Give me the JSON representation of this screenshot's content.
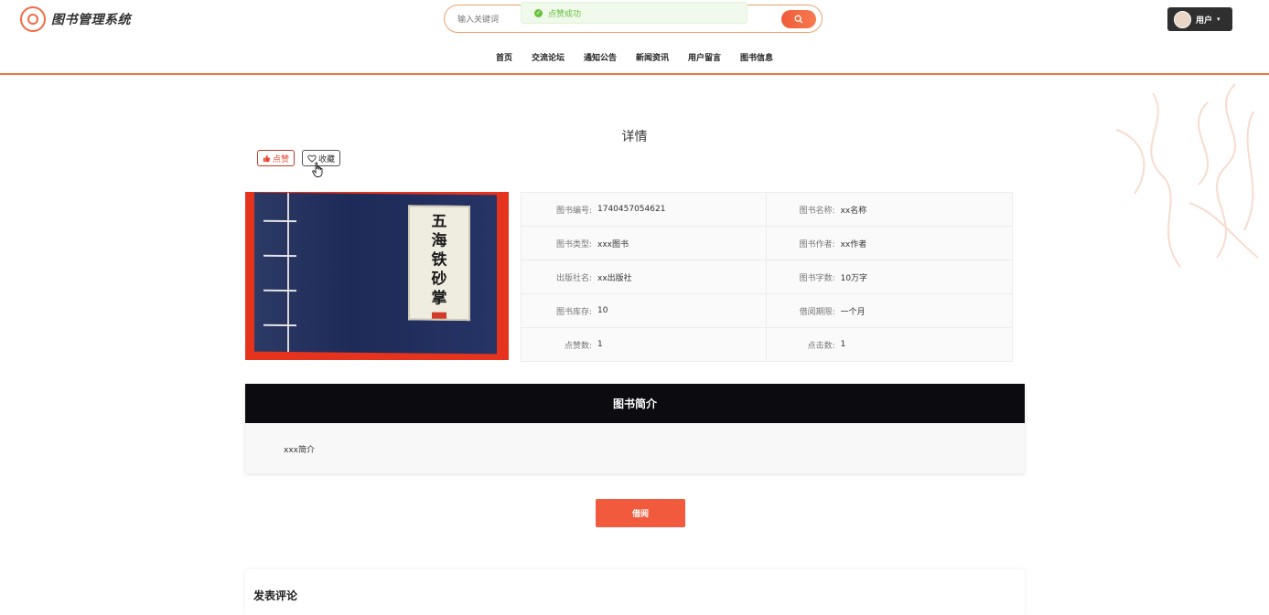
{
  "app": {
    "title": "图书管理系统"
  },
  "search": {
    "placeholder": "输入关键词"
  },
  "toast": {
    "text": "点赞成功"
  },
  "user": {
    "label": "用户"
  },
  "nav": {
    "items": [
      "首页",
      "交流论坛",
      "通知公告",
      "新闻资讯",
      "用户留言",
      "图书信息"
    ]
  },
  "detail": {
    "title": "详情"
  },
  "actions": {
    "like": "点赞",
    "favorite": "收藏"
  },
  "cover": {
    "chars": [
      "五",
      "海",
      "铁",
      "砂",
      "掌"
    ]
  },
  "info": {
    "rows": [
      [
        {
          "label": "图书编号:",
          "value": "1740457054621"
        },
        {
          "label": "图书名称:",
          "value": "xx名称"
        }
      ],
      [
        {
          "label": "图书类型:",
          "value": "xxx图书"
        },
        {
          "label": "图书作者:",
          "value": "xx作者"
        }
      ],
      [
        {
          "label": "出版社名:",
          "value": "xx出版社"
        },
        {
          "label": "图书字数:",
          "value": "10万字"
        }
      ],
      [
        {
          "label": "图书库存:",
          "value": "10"
        },
        {
          "label": "借阅期限:",
          "value": "一个月"
        }
      ],
      [
        {
          "label": "点赞数:",
          "value": "1"
        },
        {
          "label": "点击数:",
          "value": "1"
        }
      ]
    ]
  },
  "intro": {
    "heading": "图书简介",
    "text": "xxx简介"
  },
  "borrow": {
    "label": "借阅"
  },
  "comment": {
    "title": "发表评论"
  },
  "colors": {
    "accent": "#f15a3d",
    "success": "#67c23a",
    "dark": "#0b0b10"
  }
}
